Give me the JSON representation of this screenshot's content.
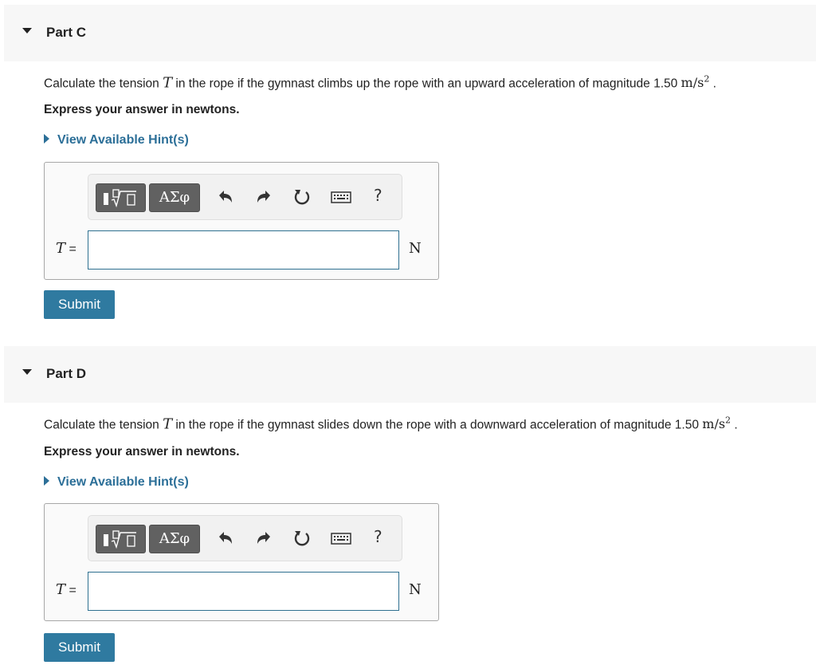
{
  "parts": [
    {
      "title": "Part C",
      "question_pre": "Calculate the tension ",
      "question_var": "T",
      "question_post": " in the rope if the gymnast climbs up the rope with an upward acceleration of magnitude 1.50 ",
      "accel_unit": "m/s",
      "accel_exp": "2",
      "question_end": " .",
      "express": "Express your answer in newtons.",
      "hint_label": "View Available Hint(s)",
      "toolbar": {
        "symbols_label": "ΑΣφ",
        "help_label": "?",
        "icons": [
          "templates-icon",
          "undo-icon",
          "redo-icon",
          "reset-icon",
          "keyboard-icon",
          "help-icon"
        ]
      },
      "var_label": "T",
      "equals": "=",
      "input_value": "",
      "unit": "N",
      "submit_label": "Submit"
    },
    {
      "title": "Part D",
      "question_pre": "Calculate the tension ",
      "question_var": "T",
      "question_post": " in the rope if the gymnast slides down the rope with a downward acceleration of magnitude 1.50 ",
      "accel_unit": "m/s",
      "accel_exp": "2",
      "question_end": " .",
      "express": "Express your answer in newtons.",
      "hint_label": "View Available Hint(s)",
      "toolbar": {
        "symbols_label": "ΑΣφ",
        "help_label": "?",
        "icons": [
          "templates-icon",
          "undo-icon",
          "redo-icon",
          "reset-icon",
          "keyboard-icon",
          "help-icon"
        ]
      },
      "var_label": "T",
      "equals": "=",
      "input_value": "",
      "unit": "N",
      "submit_label": "Submit"
    }
  ],
  "colors": {
    "link": "#2c6f98",
    "submit_bg": "#2f7aa0",
    "header_bg": "#f7f7f7",
    "toolbar_btn": "#616161"
  }
}
